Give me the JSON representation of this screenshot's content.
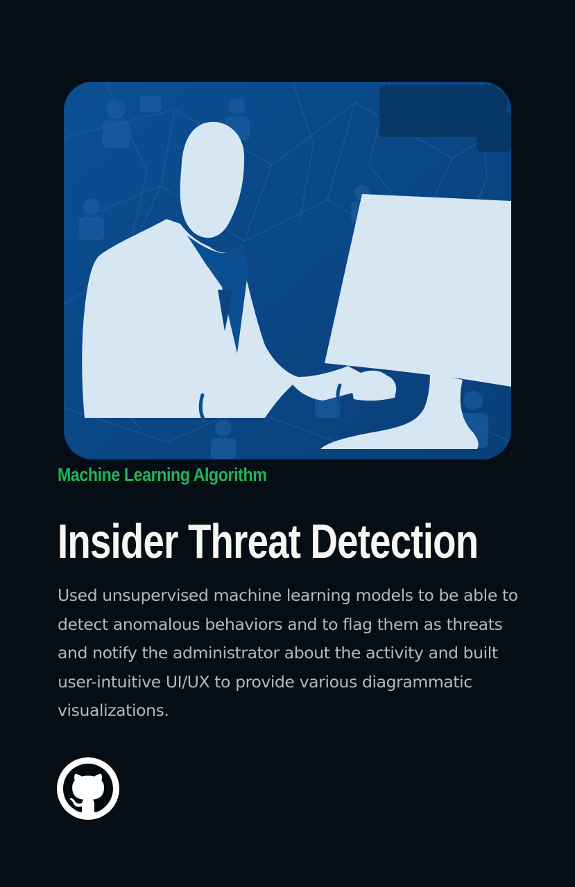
{
  "project": {
    "image_alt": "Insider threat detection illustration",
    "category": "Machine Learning Algorithm",
    "title": "Insider Threat Detection",
    "description": "Used unsupervised machine learning models to be able to detect anomalous behaviors and to flag them as threats and notify the administrator about the activity and built user-intuitive UI/UX to provide various diagrammatic visualizations.",
    "github_icon": "github-icon"
  },
  "colors": {
    "background": "#060e15",
    "accent_green": "#22b45a",
    "title": "#f7f7f2",
    "body_text": "#b4b9bd",
    "image_blue": "#0a4a8e",
    "silhouette": "#d6e6f2"
  }
}
